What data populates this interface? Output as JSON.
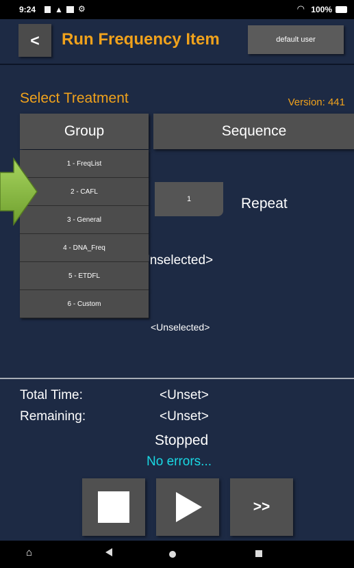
{
  "status_bar": {
    "time": "9:24",
    "battery": "100%"
  },
  "header": {
    "back_label": "<",
    "title": "Run Frequency Item",
    "user_label": "default user"
  },
  "treatment": {
    "heading": "Select Treatment",
    "version": "Version: 441"
  },
  "tabs": {
    "group": "Group",
    "sequence": "Sequence"
  },
  "group_options": [
    "1 - FreqList",
    "2 - CAFL",
    "3 - General",
    "4 - DNA_Freq",
    "5 - ETDFL",
    "6 - Custom"
  ],
  "repeat": {
    "value": "1",
    "label": "Repeat"
  },
  "selection": {
    "primary": "Unselected>",
    "secondary": "<Unselected>"
  },
  "info": {
    "total_time_label": "Total Time:",
    "total_time_value": "<Unset>",
    "remaining_label": "Remaining:",
    "remaining_value": "<Unset>",
    "state": "Stopped",
    "errors": "No errors..."
  },
  "controls": {
    "forward_label": ">>"
  },
  "colors": {
    "accent": "#f0a21c",
    "background": "#1d2a44",
    "button": "#505050",
    "status_ok": "#19d9e4",
    "arrow": "#8fc24a"
  }
}
